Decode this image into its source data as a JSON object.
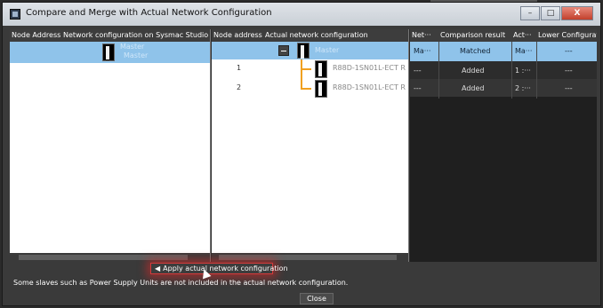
{
  "window": {
    "title": "Compare and Merge with Actual Network Configuration",
    "buttons": {
      "minimize": "–",
      "maximize": "□",
      "close": "X"
    }
  },
  "left_panel": {
    "headers": [
      "Node Address",
      "Network configuration on Sysmac Studio"
    ],
    "master_labels": [
      "Master",
      "Master"
    ]
  },
  "middle_panel": {
    "headers": [
      "Node address",
      "Actual network configuration"
    ],
    "master_label": "Master",
    "slaves": [
      {
        "node": "1",
        "name": "R88D-1SN01L-ECT R"
      },
      {
        "node": "2",
        "name": "R88D-1SN01L-ECT R"
      }
    ]
  },
  "right_panel": {
    "headers": [
      "Net···",
      "Comparison result",
      "Act···",
      "Lower Configuration"
    ],
    "rows": [
      {
        "net": "Ma···",
        "result": "Matched",
        "act": "Ma···",
        "lower": "---"
      },
      {
        "net": "---",
        "result": "Added",
        "act": "1 :···",
        "lower": "---"
      },
      {
        "net": "---",
        "result": "Added",
        "act": "2 :···",
        "lower": "---"
      }
    ]
  },
  "apply_button": "Apply actual network configuration",
  "message": "Some slaves such as Power Supply Units are not included in the actual network configuration.",
  "close_button": "Close",
  "colors": {
    "selection": "#8fc3ea",
    "wire": "#f0a020",
    "highlight": "#d43b3b"
  }
}
